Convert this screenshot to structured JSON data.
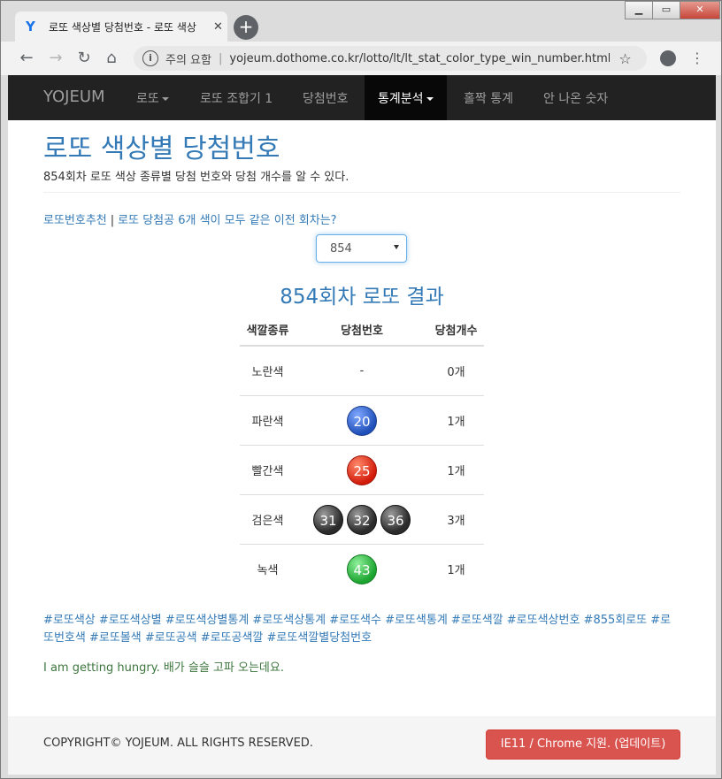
{
  "browser": {
    "tab_title": "로또 색상별 당첨번호 - 로또 색상",
    "favicon": "Y",
    "security_label": "주의 요함",
    "url": "yojeum.dothome.co.kr/lotto/lt/lt_stat_color_type_win_number.html..."
  },
  "navbar": {
    "brand": "YOJEUM",
    "items": [
      {
        "label": "로또"
      },
      {
        "label": "로또 조합기 1"
      },
      {
        "label": "당첨번호"
      },
      {
        "label": "통계분석"
      },
      {
        "label": "홀짝 통계"
      },
      {
        "label": "안 나온 숫자"
      }
    ]
  },
  "page": {
    "title": "로또 색상별 당첨번호",
    "subtitle": "854회차 로또 색상 종류별 당첨 번호와 당첨 개수를 알 수 있다.",
    "link1": "로또번호추천",
    "link2": "로또 당첨공 6개 색이 모두 같은 이전 회차는?",
    "round_select": "854",
    "result_title": "854회차 로또 결과"
  },
  "table": {
    "headers": [
      "색깔종류",
      "당첨번호",
      "당첨개수"
    ],
    "rows": [
      {
        "color": "노란색",
        "numbers": "-",
        "count": "0개"
      },
      {
        "color": "파란색",
        "numbers": [
          "20"
        ],
        "count": "1개"
      },
      {
        "color": "빨간색",
        "numbers": [
          "25"
        ],
        "count": "1개"
      },
      {
        "color": "검은색",
        "numbers": [
          "31",
          "32",
          "36"
        ],
        "count": "3개"
      },
      {
        "color": "녹색",
        "numbers": [
          "43"
        ],
        "count": "1개"
      }
    ]
  },
  "tags": "#로또색상 #로또색상별 #로또색상별통계 #로또색상통계 #로또색수 #로또색통계 #로또색깔 #로또색상번호 #855회로또 #로또번호색 #로또볼색 #로또공색 #로또공색깔 #로또색깔별당첨번호",
  "hungry_text": "I am getting hungry. 배가 슬슬 고파 오는데요.",
  "footer": {
    "copyright": "COPYRIGHT© YOJEUM. ALL RIGHTS RESERVED.",
    "update_button": "IE11 / Chrome 지원. (업데이트)"
  },
  "colors": {
    "accent": "#337ab7",
    "navbar": "#222222",
    "danger": "#d9534f",
    "success_text": "#3c763d"
  }
}
